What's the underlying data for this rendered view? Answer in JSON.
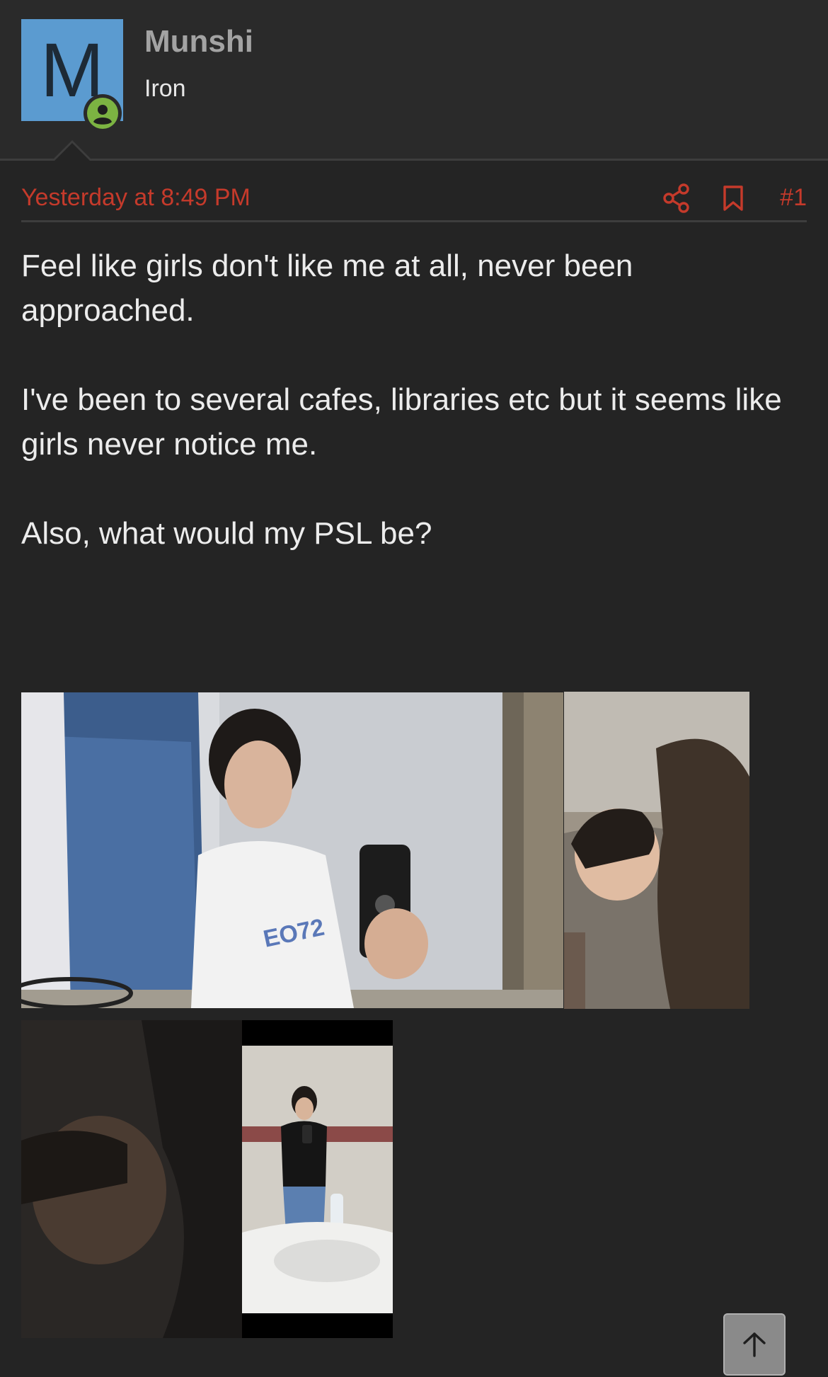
{
  "user": {
    "avatar_letter": "M",
    "name": "Munshi",
    "title": "Iron",
    "online_indicator": "user-online-icon",
    "avatar_color": "#5b9bd0",
    "online_color": "#7cb342"
  },
  "post": {
    "date": "Yesterday at 8:49 PM",
    "number": "#1",
    "paragraphs": [
      "Feel like girls don't like me at all, never been approached.",
      "I've been to several cafes, libraries etc but it seems like girls never notice me.",
      "Also, what would my PSL be?"
    ],
    "accent_color": "#c53a2b",
    "actions": [
      "share-icon",
      "bookmark-icon"
    ],
    "attachments": [
      {
        "description_icon": "mirror-selfie-photo"
      },
      {
        "description_icon": "lying-on-couch-photo"
      },
      {
        "description_icon": "dark-face-photo"
      },
      {
        "description_icon": "full-body-mirror-photo"
      }
    ]
  },
  "controls": {
    "scroll_top_icon": "arrow-up-icon"
  }
}
